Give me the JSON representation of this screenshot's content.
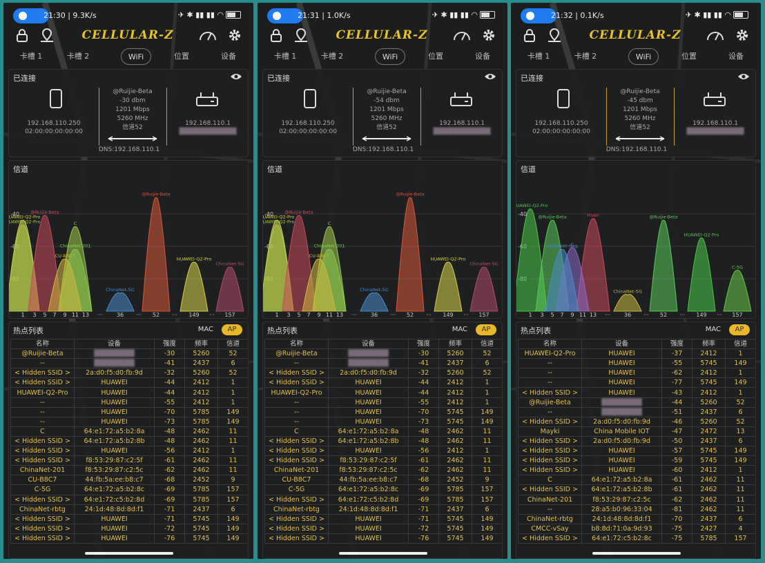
{
  "app": {
    "name": "CELLULAR-Z"
  },
  "colors": {
    "accent": "#e8c22a",
    "background": "#1c1d1f",
    "ap_pill": "#e8b82a",
    "border": "#2b8c8c"
  },
  "icons": {
    "lock": "lock-icon",
    "map": "map-pin-icon",
    "speed": "speedometer-icon",
    "settings": "gear-icon",
    "phone": "phone-icon",
    "router": "router-icon",
    "eye": "eye-icon"
  },
  "tabs": [
    "卡槽 1",
    "卡槽 2",
    "WiFi",
    "位置",
    "设备"
  ],
  "labels": {
    "connected": "已连接",
    "channel": "信道",
    "hotspots": "热点列表",
    "mac": "MAC",
    "ap": "AP",
    "columns": [
      "名称",
      "设备",
      "强度",
      "频率",
      "信道"
    ]
  },
  "x_ticks": [
    "1",
    "3",
    "5",
    "7",
    "9",
    "11",
    "13",
    "···",
    "36",
    "···",
    "52",
    "···",
    "149",
    "···",
    "157"
  ],
  "y_ticks": [
    "-40",
    "-60",
    "-80"
  ],
  "screens": [
    {
      "status_time": "21:30 | 9.3K/s",
      "status_right": "✈ ✱ ▮▮ ▮▮ ◠",
      "conn": {
        "ssid": "@Ruijie-Beta",
        "dbm": "-30 dbm",
        "speed": "1201 Mbps",
        "freq": "5260 MHz",
        "channel": "信道52",
        "client_ip": "192.168.110.250",
        "client_mac": "02:00:00:00:00:00",
        "router_ip": "192.168.110.1",
        "router_mac": "████████████",
        "dns": "DNS:192.168.110.1"
      },
      "chart_data": {
        "type": "area",
        "ylim": [
          -100,
          -20
        ],
        "series": [
          {
            "name": "HUAWEI-Q2-Pro",
            "x": "1",
            "y": -44,
            "color": "#d9d34a"
          },
          {
            "name": "HUAWEI-Q2-Pro",
            "x": "1",
            "y": -47,
            "color": "#a8c84a"
          },
          {
            "name": "@Ruijie-Beta",
            "x": "5",
            "y": -41,
            "color": "#c84a5a"
          },
          {
            "name": "ChinaNet-201",
            "x": "11",
            "y": -62,
            "color": "#6ac84a"
          },
          {
            "name": "C",
            "x": "11",
            "y": -48,
            "color": "#a0c850"
          },
          {
            "name": "CU-B8C7",
            "x": "9",
            "y": -68,
            "color": "#d0b840"
          },
          {
            "name": "@Ruijie-Beta",
            "x": "52",
            "y": -30,
            "color": "#d8583a"
          },
          {
            "name": "HUAWEI-Q2-Pro",
            "x": "149",
            "y": -70,
            "color": "#d9d34a"
          },
          {
            "name": "ChinaNet-5G",
            "x": "157",
            "y": -73,
            "color": "#b04a6a"
          },
          {
            "name": "ChinaNet-5G",
            "x": "36",
            "y": -89,
            "color": "#4a8ac8"
          }
        ]
      },
      "rows": [
        [
          "@Ruijie-Beta",
          "████████",
          "-30",
          "5260",
          "52"
        ],
        [
          "--",
          "████████",
          "-41",
          "2437",
          "6"
        ],
        [
          "< Hidden SSID >",
          "2a:d0:f5:d0:fb:9d",
          "-32",
          "5260",
          "52"
        ],
        [
          "< Hidden SSID >",
          "HUAWEI",
          "-44",
          "2412",
          "1"
        ],
        [
          "HUAWEI-Q2-Pro",
          "HUAWEI",
          "-44",
          "2412",
          "1"
        ],
        [
          "--",
          "HUAWEI",
          "-55",
          "2412",
          "1"
        ],
        [
          "--",
          "HUAWEI",
          "-70",
          "5785",
          "149"
        ],
        [
          "--",
          "HUAWEI",
          "-73",
          "5785",
          "149"
        ],
        [
          "C",
          "64:e1:72:a5:b2:8a",
          "-48",
          "2462",
          "11"
        ],
        [
          "< Hidden SSID >",
          "64:e1:72:a5:b2:8b",
          "-48",
          "2462",
          "11"
        ],
        [
          "< Hidden SSID >",
          "HUAWEI",
          "-56",
          "2412",
          "1"
        ],
        [
          "< Hidden SSID >",
          "f8:53:29:87:c2:5f",
          "-61",
          "2462",
          "11"
        ],
        [
          "ChinaNet-201",
          "f8:53:29:87:c2:5c",
          "-62",
          "2462",
          "11"
        ],
        [
          "CU-B8C7",
          "44:fb:5a:ee:b8:c7",
          "-68",
          "2452",
          "9"
        ],
        [
          "C-5G",
          "64:e1:72:a5:b2:8c",
          "-69",
          "5785",
          "157"
        ],
        [
          "< Hidden SSID >",
          "64:e1:72:c5:b2:8d",
          "-69",
          "5785",
          "157"
        ],
        [
          "ChinaNet-rbtg",
          "24:1d:48:8d:8d:f1",
          "-71",
          "2437",
          "6"
        ],
        [
          "< Hidden SSID >",
          "HUAWEI",
          "-71",
          "5745",
          "149"
        ],
        [
          "< Hidden SSID >",
          "HUAWEI",
          "-72",
          "5745",
          "149"
        ],
        [
          "< Hidden SSID >",
          "HUAWEI",
          "-76",
          "5745",
          "149"
        ]
      ]
    },
    {
      "status_time": "21:31 | 1.0K/s",
      "status_right": "✈ ✱ ▮▮ ▮▮ ◠",
      "conn": {
        "ssid": "@Ruijie-Beta",
        "dbm": "-54 dbm",
        "speed": "1201 Mbps",
        "freq": "5260 MHz",
        "channel": "信道52",
        "client_ip": "192.168.110.250",
        "client_mac": "02:00:00:00:00:00",
        "router_ip": "192.168.110.1",
        "router_mac": "████████████",
        "dns": "DNS:192.168.110.1"
      },
      "chart_data": {
        "type": "area",
        "ylim": [
          -100,
          -20
        ],
        "series": [
          {
            "name": "HUAWEI-Q2-Pro",
            "x": "1",
            "y": -44,
            "color": "#d9d34a"
          },
          {
            "name": "HUAWEI-Q2-Pro",
            "x": "1",
            "y": -47,
            "color": "#a8c84a"
          },
          {
            "name": "@Ruijie-Beta",
            "x": "5",
            "y": -41,
            "color": "#c84a5a"
          },
          {
            "name": "ChinaNet-201",
            "x": "11",
            "y": -62,
            "color": "#6ac84a"
          },
          {
            "name": "C",
            "x": "11",
            "y": -48,
            "color": "#a0c850"
          },
          {
            "name": "CU-B8C7",
            "x": "9",
            "y": -68,
            "color": "#d0b840"
          },
          {
            "name": "@Ruijie-Beta",
            "x": "52",
            "y": -30,
            "color": "#d8583a"
          },
          {
            "name": "HUAWEI-Q2-Pro",
            "x": "149",
            "y": -70,
            "color": "#d9d34a"
          },
          {
            "name": "ChinaNet-5G",
            "x": "157",
            "y": -73,
            "color": "#b04a6a"
          },
          {
            "name": "ChinaNet-5G",
            "x": "36",
            "y": -89,
            "color": "#4a8ac8"
          }
        ]
      },
      "rows": [
        [
          "@Ruijie-Beta",
          "████████",
          "-30",
          "5260",
          "52"
        ],
        [
          "--",
          "████████",
          "-41",
          "2437",
          "6"
        ],
        [
          "< Hidden SSID >",
          "2a:d0:f5:d0:fb:9d",
          "-32",
          "5260",
          "52"
        ],
        [
          "< Hidden SSID >",
          "HUAWEI",
          "-44",
          "2412",
          "1"
        ],
        [
          "HUAWEI-Q2-Pro",
          "HUAWEI",
          "-44",
          "2412",
          "1"
        ],
        [
          "--",
          "HUAWEI",
          "-55",
          "2412",
          "1"
        ],
        [
          "--",
          "HUAWEI",
          "-70",
          "5745",
          "149"
        ],
        [
          "--",
          "HUAWEI",
          "-73",
          "5745",
          "149"
        ],
        [
          "C",
          "64:e1:72:a5:b2:8a",
          "-48",
          "2462",
          "11"
        ],
        [
          "< Hidden SSID >",
          "64:e1:72:a5:b2:8b",
          "-48",
          "2462",
          "11"
        ],
        [
          "< Hidden SSID >",
          "HUAWEI",
          "-56",
          "2412",
          "1"
        ],
        [
          "< Hidden SSID >",
          "f8:53:29:87:c2:5f",
          "-61",
          "2462",
          "11"
        ],
        [
          "ChinaNet-201",
          "f8:53:29:87:c2:5c",
          "-62",
          "2462",
          "11"
        ],
        [
          "CU-B8C7",
          "44:fb:5a:ee:b8:c7",
          "-68",
          "2452",
          "9"
        ],
        [
          "C-5G",
          "64:e1:72:a5:b2:8c",
          "-69",
          "5785",
          "157"
        ],
        [
          "< Hidden SSID >",
          "64:e1:72:c5:b2:8d",
          "-69",
          "5785",
          "157"
        ],
        [
          "ChinaNet-rbtg",
          "24:1d:48:8d:8d:f1",
          "-71",
          "2437",
          "6"
        ],
        [
          "< Hidden SSID >",
          "HUAWEI",
          "-71",
          "5745",
          "149"
        ],
        [
          "< Hidden SSID >",
          "HUAWEI",
          "-72",
          "5745",
          "149"
        ],
        [
          "< Hidden SSID >",
          "HUAWEI",
          "-76",
          "5745",
          "149"
        ]
      ]
    },
    {
      "status_time": "21:32 | 0.1K/s",
      "status_right": "✈ ✱ ▮▮ ▮▮ ◠",
      "conn": {
        "ssid": "@Ruijie-Beta",
        "dbm": "-45 dbm",
        "speed": "1201 Mbps",
        "freq": "5260 MHz",
        "channel": "信道52",
        "client_ip": "192.168.110.250",
        "client_mac": "02:00:00:00:00:00",
        "router_ip": "192.168.110.1",
        "router_mac": "████████████",
        "dns": "DNS:192.168.110.1"
      },
      "chart_data": {
        "type": "area",
        "ylim": [
          -100,
          -20
        ],
        "series": [
          {
            "name": "HUAWEI-Q2-Pro",
            "x": "1",
            "y": -37,
            "color": "#4ac84a"
          },
          {
            "name": "@Ruijie-Beta",
            "x": "5",
            "y": -44,
            "color": "#5ac85a"
          },
          {
            "name": "Huan",
            "x": "13",
            "y": -43,
            "color": "#c84a5a"
          },
          {
            "name": "C",
            "x": "9",
            "y": -61,
            "color": "#8a6ac8"
          },
          {
            "name": "ChinaNet-rbtg",
            "x": "7",
            "y": -62,
            "color": "#4a8ac8"
          },
          {
            "name": "ChinaNet-5G",
            "x": "36",
            "y": -90,
            "color": "#c8b840"
          },
          {
            "name": "@Ruijie-Beta",
            "x": "52",
            "y": -44,
            "color": "#5ac85a"
          },
          {
            "name": "HUAWEI-Q2-Pro",
            "x": "149",
            "y": -55,
            "color": "#4ac84a"
          },
          {
            "name": "C-5G",
            "x": "157",
            "y": -75,
            "color": "#6ac84a"
          }
        ]
      },
      "rows": [
        [
          "HUAWEI-Q2-Pro",
          "HUAWEI",
          "-37",
          "2412",
          "1"
        ],
        [
          "--",
          "HUAWEI",
          "-55",
          "5745",
          "149"
        ],
        [
          "--",
          "HUAWEI",
          "-62",
          "2412",
          "1"
        ],
        [
          "--",
          "HUAWEI",
          "-77",
          "5745",
          "149"
        ],
        [
          "< Hidden SSID >",
          "HUAWEI",
          "-43",
          "2412",
          "1"
        ],
        [
          "@Ruijie-Beta",
          "████████",
          "-44",
          "5260",
          "52"
        ],
        [
          "--",
          "████████",
          "-51",
          "2437",
          "6"
        ],
        [
          "< Hidden SSID >",
          "2a:d0:f5:d0:fb:9d",
          "-46",
          "5260",
          "52"
        ],
        [
          "Mayki",
          "China Mobile IOT",
          "-47",
          "2472",
          "13"
        ],
        [
          "< Hidden SSID >",
          "2a:d0:f5:d0:fb:9d",
          "-50",
          "2437",
          "6"
        ],
        [
          "< Hidden SSID >",
          "HUAWEI",
          "-57",
          "5745",
          "149"
        ],
        [
          "< Hidden SSID >",
          "HUAWEI",
          "-59",
          "5745",
          "149"
        ],
        [
          "< Hidden SSID >",
          "HUAWEI",
          "-60",
          "2412",
          "1"
        ],
        [
          "C",
          "64:e1:72:a5:b2:8a",
          "-61",
          "2462",
          "11"
        ],
        [
          "< Hidden SSID >",
          "64:e1:72:a5:b2:8b",
          "-61",
          "2462",
          "11"
        ],
        [
          "ChinaNet-201",
          "f8:53:29:87:c2:5c",
          "-62",
          "2462",
          "11"
        ],
        [
          "--",
          "28:a5:b0:96:33:04",
          "-81",
          "2462",
          "11"
        ],
        [
          "ChinaNet-rbtg",
          "24:1d:48:8d:8d:f1",
          "-70",
          "2437",
          "6"
        ],
        [
          "CMCC-vSay",
          "b8:8d:71:0a:9d:93",
          "-75",
          "2427",
          "4"
        ],
        [
          "< Hidden SSID >",
          "64:e1:72:c5:b2:8c",
          "-75",
          "5785",
          "157"
        ]
      ]
    }
  ]
}
